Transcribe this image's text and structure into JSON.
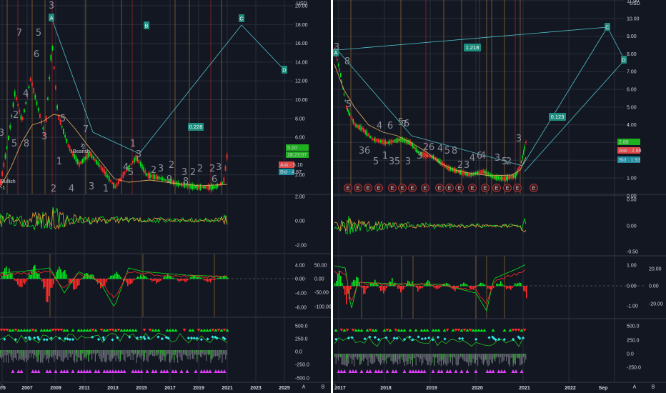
{
  "left": {
    "currency": "USD",
    "price_ticks": [
      "20.00",
      "18.00",
      "16.00",
      "14.00",
      "12.00",
      "10.00",
      "8.00",
      "6.00",
      "4.00",
      "2.00"
    ],
    "osc1_ticks": [
      "2.00",
      "0.00",
      "-2.00"
    ],
    "osc2_ticks": [
      "4.00",
      "0.00",
      "-4.00",
      "-8.00"
    ],
    "osc2_right_ticks": [
      "50.00",
      "0.00",
      "-50.00",
      "-100.00"
    ],
    "osc3_ticks": [
      "500.0",
      "250.0",
      "0.0",
      "-250.0",
      "-500.0"
    ],
    "x_labels": [
      "05",
      "2007",
      "2009",
      "2011",
      "2013",
      "2015",
      "2017",
      "2019",
      "2021",
      "2023",
      "2025"
    ],
    "points": {
      "a": "A",
      "b": "B",
      "c": "C",
      "d": "D"
    },
    "ratio_label": "0.228",
    "price_tag": "5.10",
    "countdown": "18:23:07",
    "ask": "Ask · 5.10",
    "bid": "Bid · 4.87",
    "text_bullish": "Bullish",
    "text_bearish": "Bearish",
    "text_minus1": "-1",
    "text_two": "2",
    "wave_labels": [
      "3",
      "5",
      "7",
      "6",
      "4",
      "3",
      "2",
      "5",
      "8",
      "5",
      "1",
      "3",
      "5",
      "4",
      "7",
      "2",
      "3",
      "1",
      "3",
      "2",
      "3",
      "2",
      "3",
      "2",
      "2",
      "2",
      "3",
      "4",
      "5",
      "6",
      "8",
      "9",
      "1"
    ],
    "e_icon": "A",
    "e_icon2": "B"
  },
  "right": {
    "currency": "USD",
    "price_ticks": [
      "11.00",
      "10.00",
      "9.00",
      "8.00",
      "7.00",
      "6.00",
      "5.00",
      "4.00",
      "3.00",
      "2.00",
      "1.00",
      "0.00"
    ],
    "osc1_ticks": [
      "0.50",
      "0.00",
      "-0.50"
    ],
    "osc2_ticks": [
      "1.00",
      "0.00",
      "-1.00"
    ],
    "osc2_right_ticks": [
      "20.00",
      "0.00",
      "-20.00"
    ],
    "osc3_ticks": [
      "500.0",
      "250.0",
      "0.0",
      "-250.0"
    ],
    "x_labels": [
      "2017",
      "2018",
      "2019",
      "2020",
      "2021",
      "2022",
      "Sep"
    ],
    "points": {
      "a": "A",
      "c": "C",
      "d": "D"
    },
    "ratio_top": "1.218",
    "ratio_label": "0.123",
    "price_tag": "2.88",
    "ask": "Ask · 2.88",
    "bid": "Bid · 1.93",
    "earnings_marker": "E",
    "wave_labels": [
      "3",
      "8",
      "5",
      "3",
      "4",
      "6",
      "5",
      "7",
      "6",
      "3",
      "5",
      "3",
      "5",
      "2",
      "6",
      "4",
      "5",
      "8",
      "2",
      "3",
      "4",
      "6",
      "3",
      "5",
      "2",
      "1",
      "6",
      "4",
      "3"
    ],
    "e_icon": "A",
    "e_icon2": "B"
  },
  "chart_data": [
    {
      "type": "line",
      "title": "",
      "xlabel": "",
      "ylabel": "USD",
      "x": [
        "2005",
        "2007",
        "2009",
        "2011",
        "2013",
        "2015",
        "2017",
        "2019",
        "2021"
      ],
      "series": [
        {
          "values": [
            1.2,
            6.5,
            17.5,
            6.0,
            3.0,
            3.4,
            3.1,
            3.0,
            5.1
          ]
        }
      ],
      "projection": {
        "A": [
          "2009",
          18.4
        ],
        "B": [
          "2015",
          2.6
        ],
        "C": [
          "2022",
          17.8
        ],
        "D": [
          "2025",
          13.5
        ]
      },
      "ylim": [
        1,
        20
      ],
      "grid": true,
      "annotations": [
        "0.228"
      ]
    },
    {
      "type": "line",
      "title": "",
      "xlabel": "",
      "ylabel": "USD",
      "x": [
        "2017",
        "2018",
        "2019",
        "2020",
        "2021"
      ],
      "series": [
        {
          "values": [
            7.5,
            4.0,
            3.0,
            1.2,
            2.88
          ]
        }
      ],
      "projection": {
        "A": [
          "2017",
          7.8
        ],
        "C": [
          "2022.7",
          9.3
        ],
        "D": [
          "2023",
          7.9
        ]
      },
      "ylim": [
        0,
        11
      ],
      "grid": true,
      "annotations": [
        "1.218",
        "0.123"
      ]
    }
  ],
  "colors": {
    "bg": "#131722",
    "grid": "#2a2e39",
    "up": "#26a69a",
    "down": "#ef5350",
    "green": "#00e61a",
    "red": "#ff2a2a",
    "orange": "#e8a33d",
    "teal_label": "#1e8c7e",
    "axis_text": "#d1d4dc",
    "ma": "#d9a35b",
    "projection": "#4fc2c9"
  }
}
